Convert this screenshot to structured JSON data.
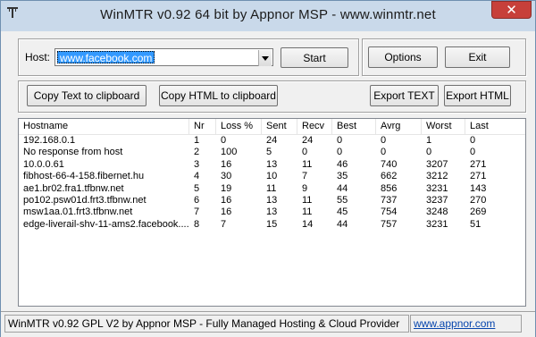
{
  "window": {
    "title": "WinMTR v0.92 64 bit by Appnor MSP - www.winmtr.net"
  },
  "host": {
    "label": "Host:",
    "value": "www.facebook.com"
  },
  "buttons": {
    "start": "Start",
    "options": "Options",
    "exit": "Exit",
    "copy_text": "Copy Text to clipboard",
    "copy_html": "Copy HTML to clipboard",
    "export_text": "Export TEXT",
    "export_html": "Export HTML"
  },
  "table": {
    "columns": [
      "Hostname",
      "Nr",
      "Loss %",
      "Sent",
      "Recv",
      "Best",
      "Avrg",
      "Worst",
      "Last"
    ],
    "rows": [
      [
        "192.168.0.1",
        "1",
        "0",
        "24",
        "24",
        "0",
        "0",
        "1",
        "0"
      ],
      [
        "No response from host",
        "2",
        "100",
        "5",
        "0",
        "0",
        "0",
        "0",
        "0"
      ],
      [
        "10.0.0.61",
        "3",
        "16",
        "13",
        "11",
        "46",
        "740",
        "3207",
        "271"
      ],
      [
        "fibhost-66-4-158.fibernet.hu",
        "4",
        "30",
        "10",
        "7",
        "35",
        "662",
        "3212",
        "271"
      ],
      [
        "ae1.br02.fra1.tfbnw.net",
        "5",
        "19",
        "11",
        "9",
        "44",
        "856",
        "3231",
        "143"
      ],
      [
        "po102.psw01d.frt3.tfbnw.net",
        "6",
        "16",
        "13",
        "11",
        "55",
        "737",
        "3237",
        "270"
      ],
      [
        "msw1aa.01.frt3.tfbnw.net",
        "7",
        "16",
        "13",
        "11",
        "45",
        "754",
        "3248",
        "269"
      ],
      [
        "edge-liverail-shv-11-ams2.facebook....",
        "8",
        "7",
        "15",
        "14",
        "44",
        "757",
        "3231",
        "51"
      ]
    ]
  },
  "status": {
    "text": "WinMTR v0.92 GPL V2 by Appnor MSP - Fully Managed Hosting & Cloud Provider",
    "link": "www.appnor.com"
  },
  "icons": {
    "app": "winmtr-app-icon",
    "close": "close-icon",
    "dropdown": "chevron-down-icon"
  },
  "colors": {
    "titlebar": "#c9d9ea",
    "close": "#c7403a",
    "selection": "#3399ff",
    "link": "#0645ad"
  }
}
